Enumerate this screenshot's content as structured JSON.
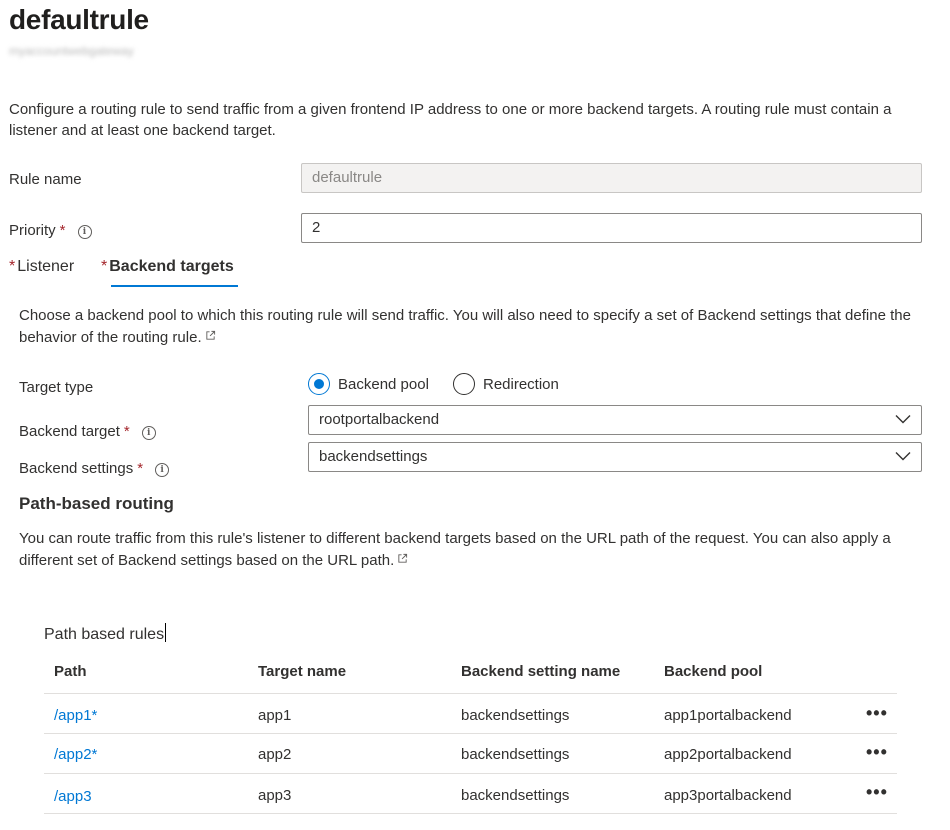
{
  "header": {
    "title": "defaultrule",
    "subtitle": "myaccountwebgateway"
  },
  "intro": "Configure a routing rule to send traffic from a given frontend IP address to one or more backend targets. A routing rule must contain a listener and at least one backend target.",
  "rule_name": {
    "label": "Rule name",
    "value": "defaultrule"
  },
  "priority": {
    "label": "Priority",
    "required": "*",
    "value": "2"
  },
  "tabs": [
    {
      "label": "Listener",
      "star": "*"
    },
    {
      "label": "Backend targets",
      "star": "*"
    }
  ],
  "backend": {
    "description": "Choose a backend pool to which this routing rule will send traffic. You will also need to specify a set of Backend settings that define the behavior of the routing rule.",
    "target_type_label": "Target type",
    "target_type_options": [
      "Backend pool",
      "Redirection"
    ],
    "target_type_selected": "Backend pool",
    "backend_target_label": "Backend target",
    "backend_target_value": "rootportalbackend",
    "backend_settings_label": "Backend settings",
    "backend_settings_value": "backendsettings",
    "required": "*"
  },
  "path_routing": {
    "heading": "Path-based routing",
    "description": "You can route traffic from this rule's listener to different backend targets based on the URL path of the request. You can also apply a different set of Backend settings based on the URL path.",
    "grid_title": "Path based rules",
    "columns": [
      "Path",
      "Target name",
      "Backend setting name",
      "Backend pool"
    ],
    "rows": [
      {
        "path": "/app1*",
        "target": "app1",
        "setting": "backendsettings",
        "pool": "app1portalbackend",
        "more": "•••"
      },
      {
        "path": "/app2*",
        "target": "app2",
        "setting": "backendsettings",
        "pool": "app2portalbackend",
        "more": "•••"
      },
      {
        "path": "/app3",
        "target": "app3",
        "setting": "backendsettings",
        "pool": "app3portalbackend",
        "more": "•••"
      }
    ]
  },
  "icons": {
    "info": "info-icon",
    "external_link": "external-link-icon",
    "dropdown": "chevron-down-icon",
    "more": "more-icon"
  },
  "colors": {
    "accent": "#0078d4",
    "required": "#a4262c",
    "border": "#8a8886",
    "disabled_bg": "#f3f2f1"
  }
}
